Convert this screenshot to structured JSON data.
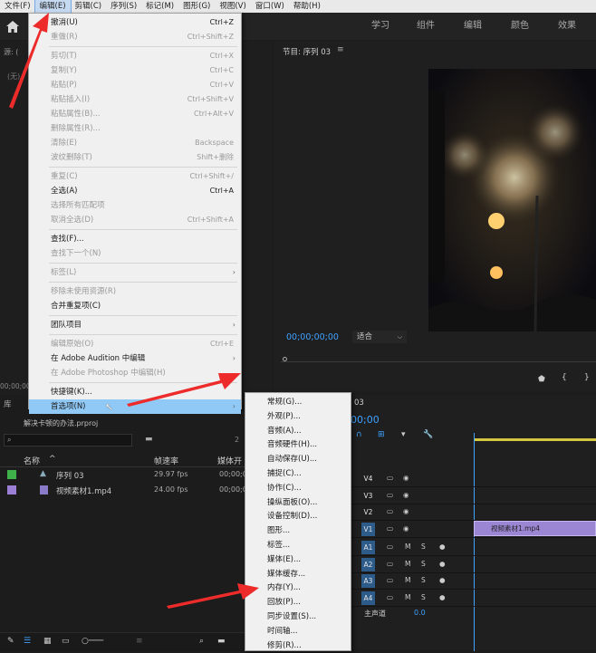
{
  "menubar": {
    "items": [
      "文件(F)",
      "编辑(E)",
      "剪辑(C)",
      "序列(S)",
      "标记(M)",
      "图形(G)",
      "视图(V)",
      "窗口(W)",
      "帮助(H)"
    ],
    "active_index": 1
  },
  "workspace_tabs": [
    "学习",
    "组件",
    "编辑",
    "颜色",
    "效果"
  ],
  "program_monitor": {
    "title": "节目: 序列 03",
    "timecode": "00;00;00;00",
    "fit": "适合"
  },
  "left_top": {
    "source_label": "源: (",
    "effects_label": "(无)"
  },
  "project_panel": {
    "tab_label": "库",
    "file_name": "解决卡顿的办法.prproj",
    "search_placeholder": "",
    "count": "2",
    "columns": [
      "名称",
      "帧速率",
      "媒体开"
    ],
    "rows": [
      {
        "name": "序列 03",
        "fps": "29.97 fps",
        "start": "00;00;0",
        "color": "#3fb14a"
      },
      {
        "name": "视频素材1.mp4",
        "fps": "24.00 fps",
        "start": "00;00;0",
        "color": "#9b7fd6"
      }
    ],
    "timecode_left": "00;00;00"
  },
  "edit_menu": {
    "items": [
      {
        "label": "撤消(U)",
        "shortcut": "Ctrl+Z",
        "disabled": false
      },
      {
        "label": "重做(R)",
        "shortcut": "Ctrl+Shift+Z",
        "disabled": true
      },
      {
        "sep": true
      },
      {
        "label": "剪切(T)",
        "shortcut": "Ctrl+X",
        "disabled": true
      },
      {
        "label": "复制(Y)",
        "shortcut": "Ctrl+C",
        "disabled": true
      },
      {
        "label": "粘贴(P)",
        "shortcut": "Ctrl+V",
        "disabled": true
      },
      {
        "label": "粘贴插入(I)",
        "shortcut": "Ctrl+Shift+V",
        "disabled": true
      },
      {
        "label": "粘贴属性(B)...",
        "shortcut": "Ctrl+Alt+V",
        "disabled": true
      },
      {
        "label": "删除属性(R)...",
        "shortcut": "",
        "disabled": true
      },
      {
        "label": "清除(E)",
        "shortcut": "Backspace",
        "disabled": true
      },
      {
        "label": "波纹删除(T)",
        "shortcut": "Shift+删除",
        "disabled": true
      },
      {
        "sep": true
      },
      {
        "label": "重复(C)",
        "shortcut": "Ctrl+Shift+/",
        "disabled": true
      },
      {
        "label": "全选(A)",
        "shortcut": "Ctrl+A",
        "disabled": false
      },
      {
        "label": "选择所有匹配项",
        "shortcut": "",
        "disabled": true
      },
      {
        "label": "取消全选(D)",
        "shortcut": "Ctrl+Shift+A",
        "disabled": true
      },
      {
        "sep": true
      },
      {
        "label": "查找(F)...",
        "shortcut": "",
        "disabled": false
      },
      {
        "label": "查找下一个(N)",
        "shortcut": "",
        "disabled": true
      },
      {
        "sep": true
      },
      {
        "label": "标签(L)",
        "shortcut": "",
        "disabled": true,
        "submenu": true
      },
      {
        "sep": true
      },
      {
        "label": "移除未使用资源(R)",
        "shortcut": "",
        "disabled": true
      },
      {
        "label": "合并重复项(C)",
        "shortcut": "",
        "disabled": false
      },
      {
        "sep": true
      },
      {
        "label": "团队项目",
        "shortcut": "",
        "disabled": false,
        "submenu": true
      },
      {
        "sep": true
      },
      {
        "label": "编辑原始(O)",
        "shortcut": "Ctrl+E",
        "disabled": true
      },
      {
        "label": "在 Adobe Audition 中编辑",
        "shortcut": "",
        "disabled": false,
        "submenu": true
      },
      {
        "label": "在 Adobe Photoshop 中编辑(H)",
        "shortcut": "",
        "disabled": true
      },
      {
        "sep": true
      },
      {
        "label": "快捷键(K)...",
        "shortcut": "",
        "disabled": false
      },
      {
        "label": "首选项(N)",
        "shortcut": "",
        "disabled": false,
        "submenu": true,
        "highlight": true
      }
    ]
  },
  "prefs_submenu": {
    "items": [
      "常规(G)...",
      "外观(P)...",
      "音频(A)...",
      "音频硬件(H)...",
      "自动保存(U)...",
      "捕捉(C)...",
      "协作(C)...",
      "操纵面板(O)...",
      "设备控制(D)...",
      "图形...",
      "标签...",
      "媒体(E)...",
      "媒体缓存...",
      "内存(Y)...",
      "回放(P)...",
      "同步设置(S)...",
      "时间轴...",
      "修剪(R)..."
    ]
  },
  "timeline": {
    "tab": "03",
    "timecode": "00;00",
    "video_tracks": [
      "V4",
      "V3",
      "V2",
      "V1"
    ],
    "audio_tracks": [
      "A1",
      "A2",
      "A3",
      "A4"
    ],
    "clip_name": "视频素材1.mp4",
    "master_label": "主声道",
    "master_value": "0.0"
  },
  "colors": {
    "accent": "#2d8ceb",
    "clip": "#9b86d4",
    "arrow": "#ee2b2b",
    "highlight": "#90c8f6"
  }
}
